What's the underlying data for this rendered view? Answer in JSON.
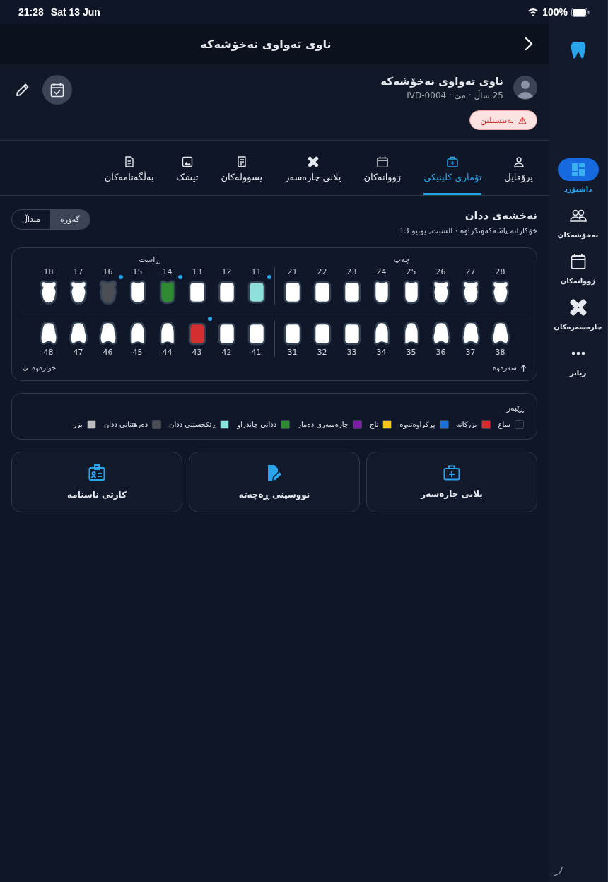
{
  "status_bar": {
    "time": "21:28",
    "date": "Sat 13 Jun",
    "battery": "100%"
  },
  "header": {
    "title": "ناوی تەواوی نەخۆشەکە"
  },
  "patient": {
    "name": "ناوی تەواوی نەخۆشەکە",
    "details": "25 ساڵ · مێ · IVD-0004",
    "allergy": "پەنیسیلین"
  },
  "tabs": [
    {
      "label": "پرۆفایل",
      "selected": false
    },
    {
      "label": "تۆماری کلینیکی",
      "selected": true
    },
    {
      "label": "ژووانەکان",
      "selected": false
    },
    {
      "label": "پلانی چارەسەر",
      "selected": false
    },
    {
      "label": "پسوولەکان",
      "selected": false
    },
    {
      "label": "تیشک",
      "selected": false
    },
    {
      "label": "بەڵگەنامەکان",
      "selected": false
    }
  ],
  "chart": {
    "title": "نەخشەی ددان",
    "subtitle": "خۆکارانە پاشەکەوتکراوە · السبت, يونيو 13",
    "toggle": [
      {
        "label": "گەورە",
        "selected": true
      },
      {
        "label": "منداڵ",
        "selected": false
      }
    ],
    "side_left": "چەپ",
    "side_right": "ڕاست",
    "upper_left": [
      {
        "number": "28",
        "kind": "molar",
        "color": "#ffffff",
        "marked": false
      },
      {
        "number": "27",
        "kind": "molar",
        "color": "#ffffff",
        "marked": false
      },
      {
        "number": "26",
        "kind": "molar",
        "color": "#ffffff",
        "marked": false
      },
      {
        "number": "25",
        "kind": "premolar",
        "color": "#ffffff",
        "marked": false
      },
      {
        "number": "24",
        "kind": "premolar",
        "color": "#ffffff",
        "marked": false
      },
      {
        "number": "23",
        "kind": "front",
        "color": "#ffffff",
        "marked": false
      },
      {
        "number": "22",
        "kind": "front",
        "color": "#ffffff",
        "marked": false
      },
      {
        "number": "21",
        "kind": "front",
        "color": "#ffffff",
        "marked": false
      }
    ],
    "upper_right": [
      {
        "number": "11",
        "kind": "front",
        "color": "#8ee0dc",
        "marked": true
      },
      {
        "number": "12",
        "kind": "front",
        "color": "#ffffff",
        "marked": false
      },
      {
        "number": "13",
        "kind": "front",
        "color": "#ffffff",
        "marked": false
      },
      {
        "number": "14",
        "kind": "premolar",
        "color": "#2e8b32",
        "marked": true
      },
      {
        "number": "15",
        "kind": "premolar",
        "color": "#ffffff",
        "marked": false
      },
      {
        "number": "16",
        "kind": "molar",
        "color": "#4b4f55",
        "marked": true
      },
      {
        "number": "17",
        "kind": "molar",
        "color": "#ffffff",
        "marked": false
      },
      {
        "number": "18",
        "kind": "molar",
        "color": "#ffffff",
        "marked": false
      }
    ],
    "lower_left": [
      {
        "number": "38",
        "kind": "lower-molar",
        "color": "#ffffff",
        "marked": false
      },
      {
        "number": "37",
        "kind": "lower-molar",
        "color": "#ffffff",
        "marked": false
      },
      {
        "number": "36",
        "kind": "lower-molar",
        "color": "#ffffff",
        "marked": false
      },
      {
        "number": "35",
        "kind": "lower-premolar",
        "color": "#ffffff",
        "marked": false
      },
      {
        "number": "34",
        "kind": "lower-premolar",
        "color": "#ffffff",
        "marked": false
      },
      {
        "number": "33",
        "kind": "front",
        "color": "#ffffff",
        "marked": false
      },
      {
        "number": "32",
        "kind": "front",
        "color": "#ffffff",
        "marked": false
      },
      {
        "number": "31",
        "kind": "front",
        "color": "#ffffff",
        "marked": false
      }
    ],
    "lower_right": [
      {
        "number": "41",
        "kind": "front",
        "color": "#ffffff",
        "marked": false
      },
      {
        "number": "42",
        "kind": "front",
        "color": "#ffffff",
        "marked": false
      },
      {
        "number": "43",
        "kind": "front",
        "color": "#d32f2f",
        "marked": true
      },
      {
        "number": "44",
        "kind": "lower-premolar",
        "color": "#ffffff",
        "marked": false
      },
      {
        "number": "45",
        "kind": "lower-premolar",
        "color": "#ffffff",
        "marked": false
      },
      {
        "number": "46",
        "kind": "lower-molar",
        "color": "#ffffff",
        "marked": false
      },
      {
        "number": "47",
        "kind": "lower-molar",
        "color": "#ffffff",
        "marked": false
      },
      {
        "number": "48",
        "kind": "lower-molar",
        "color": "#ffffff",
        "marked": false
      }
    ],
    "upper_hint": "سەرەوە",
    "lower_hint": "خوارەوە"
  },
  "legend": {
    "title": "ڕێبەر",
    "items": [
      {
        "label": "ساغ",
        "color": "#111827"
      },
      {
        "label": "بزرکانە",
        "color": "#d32f2f"
      },
      {
        "label": "پڕکراوەتەوە",
        "color": "#1e6fd0"
      },
      {
        "label": "تاج",
        "color": "#f5c518"
      },
      {
        "label": "چارەسەری دەمار",
        "color": "#7b1fa2"
      },
      {
        "label": "ددانی چاندراو",
        "color": "#2e8b32"
      },
      {
        "label": "ڕێکخستنی ددان",
        "color": "#8ee0dc"
      },
      {
        "label": "دەرهێنانی ددان",
        "color": "#4b4f55"
      },
      {
        "label": "بزر",
        "color": "#bdbdbd"
      }
    ]
  },
  "actions": [
    {
      "label": "پلانی چارەسەر"
    },
    {
      "label": "نووسینی ڕەچەتە"
    },
    {
      "label": "کارتی ناسنامە"
    }
  ],
  "sidebar": [
    {
      "label": "داشبۆرد",
      "selected": true
    },
    {
      "label": "نەخۆشەکان",
      "selected": false
    },
    {
      "label": "ژووانەکان",
      "selected": false
    },
    {
      "label": "چارەسەرەکان",
      "selected": false
    },
    {
      "label": "زیاتر",
      "selected": false
    }
  ]
}
